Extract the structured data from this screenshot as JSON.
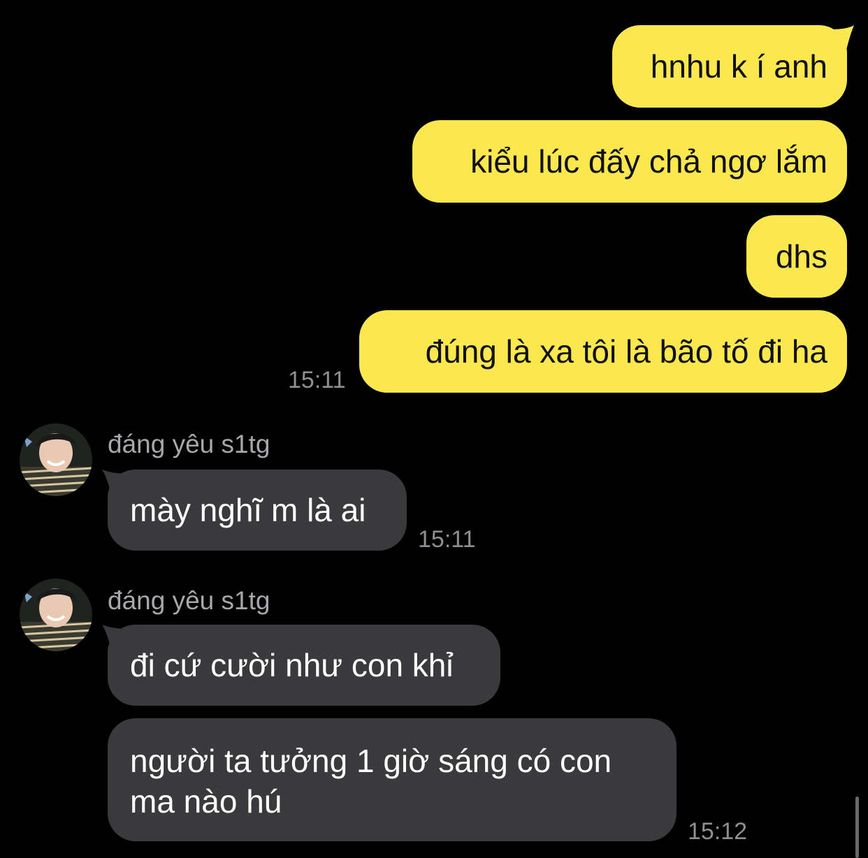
{
  "colors": {
    "background": "#000000",
    "outgoing_bubble": "#FBE84F",
    "incoming_bubble": "#3A3A3C",
    "timestamp": "#8E8E93",
    "sender_name": "#A8A8AC"
  },
  "outgoing": {
    "messages": [
      {
        "text": "hnhu k í anh"
      },
      {
        "text": "kiểu lúc đấy chả ngơ lắm"
      },
      {
        "text": "dhs"
      },
      {
        "text": "đúng là xa tôi là bão tố đi ha"
      }
    ],
    "time": "15:11"
  },
  "incoming_groups": [
    {
      "sender": "đáng yêu s1tg",
      "avatar_icon": "profile-photo-avatar",
      "messages": [
        {
          "text": "mày nghĩ m là ai"
        }
      ],
      "time": "15:11"
    },
    {
      "sender": "đáng yêu s1tg",
      "avatar_icon": "profile-photo-avatar",
      "messages": [
        {
          "text": "đi cứ cười như con khỉ"
        },
        {
          "line1": "người ta tưởng 1 giờ sáng có con",
          "line2": "ma nào hú"
        }
      ],
      "time": "15:12"
    }
  ]
}
